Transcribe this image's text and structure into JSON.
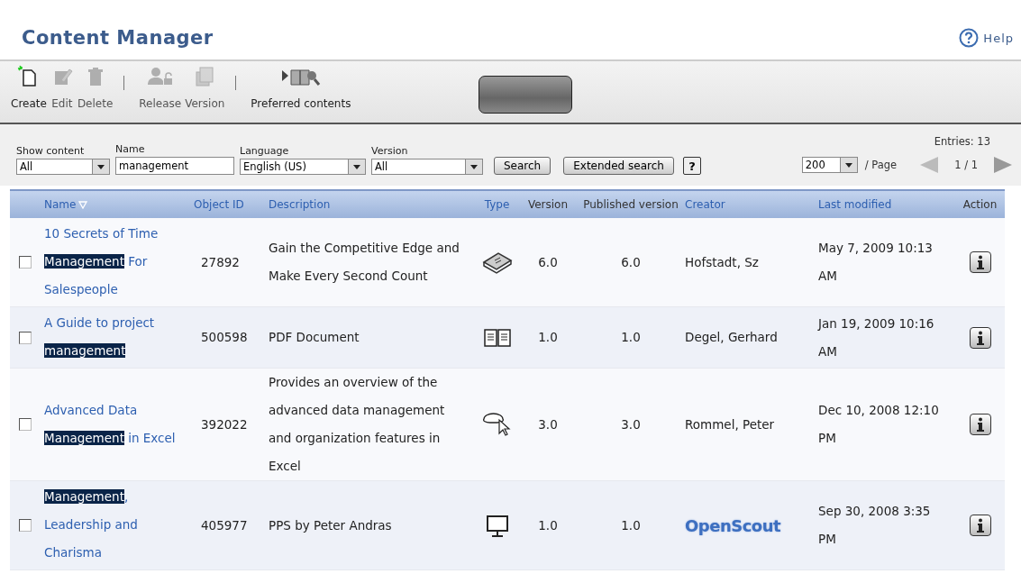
{
  "header": {
    "title": "Content Manager",
    "help": "Help"
  },
  "toolbar": {
    "buttons": [
      {
        "kind": "button",
        "label": "Create",
        "disabled": false
      },
      {
        "kind": "button",
        "label": "Edit",
        "disabled": true
      },
      {
        "kind": "button",
        "label": "Delete",
        "disabled": true
      },
      {
        "kind": "separator"
      },
      {
        "kind": "button",
        "label": "Release",
        "disabled": true
      },
      {
        "kind": "button",
        "label": "Version",
        "disabled": true
      },
      {
        "kind": "separator"
      },
      {
        "kind": "button",
        "label": "Preferred contents",
        "disabled": false
      }
    ]
  },
  "filters": {
    "fields": [
      {
        "label": "Show content",
        "kind": "select",
        "value": "All"
      },
      {
        "label": "Name",
        "kind": "input",
        "value": "management"
      },
      {
        "label": "Language",
        "kind": "select",
        "value": "English (US)"
      },
      {
        "label": "Version",
        "kind": "select",
        "value": "All"
      }
    ],
    "search_button": "Search",
    "extended_button": "Extended search",
    "help_button": "?",
    "per_page": "200",
    "per_page_label": "/ Page",
    "page": "1 / 1",
    "entries": "Entries: 13"
  },
  "table": {
    "columns": [
      {
        "label": "Name",
        "sortable": true,
        "sorted": true
      },
      {
        "label": "Object ID",
        "sortable": true,
        "sorted": false
      },
      {
        "label": "Description",
        "sortable": true,
        "sorted": false
      },
      {
        "label": "Type",
        "sortable": true,
        "sorted": false
      },
      {
        "label": "Version",
        "sortable": false,
        "sorted": false
      },
      {
        "label": "Published version",
        "sortable": false,
        "sorted": false
      },
      {
        "label": "Creator",
        "sortable": true,
        "sorted": false
      },
      {
        "label": "Last modified",
        "sortable": true,
        "sorted": false
      },
      {
        "label": "Action",
        "sortable": false,
        "sorted": false
      }
    ],
    "rows": [
      {
        "checked": false,
        "name": [
          {
            "text": "10 Secrets of Time ",
            "highlighted": false
          },
          {
            "text": "Management",
            "highlighted": true
          },
          {
            "text": " For Salespeople",
            "highlighted": false
          }
        ],
        "object_id": "27892",
        "description": "Gain the Competitive Edge and Make Every Second Count",
        "kind": "book",
        "version": "6.0",
        "published_version": "6.0",
        "creator": {
          "kind": "text",
          "text": "Hofstadt, Sz"
        },
        "last_modified": "May 7, 2009 10:13 AM"
      },
      {
        "checked": false,
        "name": [
          {
            "text": "A Guide to project ",
            "highlighted": false
          },
          {
            "text": "management",
            "highlighted": true
          }
        ],
        "object_id": "500598",
        "description": "PDF Document",
        "kind": "document",
        "version": "1.0",
        "published_version": "1.0",
        "creator": {
          "kind": "text",
          "text": "Degel, Gerhard"
        },
        "last_modified": "Jan 19, 2009 10:16 AM"
      },
      {
        "checked": false,
        "name": [
          {
            "text": "Advanced Data ",
            "highlighted": false
          },
          {
            "text": "Management",
            "highlighted": true
          },
          {
            "text": " in Excel",
            "highlighted": false
          }
        ],
        "object_id": "392022",
        "description": "Provides an overview of the advanced data management and organization features in Excel",
        "kind": "interactive",
        "version": "3.0",
        "published_version": "3.0",
        "creator": {
          "kind": "text",
          "text": "Rommel, Peter"
        },
        "last_modified": "Dec 10, 2008 12:10 PM"
      },
      {
        "checked": false,
        "name": [
          {
            "text": "Management",
            "highlighted": true
          },
          {
            "text": ", Leadership and Charisma",
            "highlighted": false
          }
        ],
        "object_id": "405977",
        "description": "PPS by Peter Andras",
        "kind": "presentation",
        "version": "1.0",
        "published_version": "1.0",
        "creator": {
          "kind": "logo",
          "text": "OpenScout"
        },
        "last_modified": "Sep 30, 2008 3:35 PM"
      }
    ]
  }
}
